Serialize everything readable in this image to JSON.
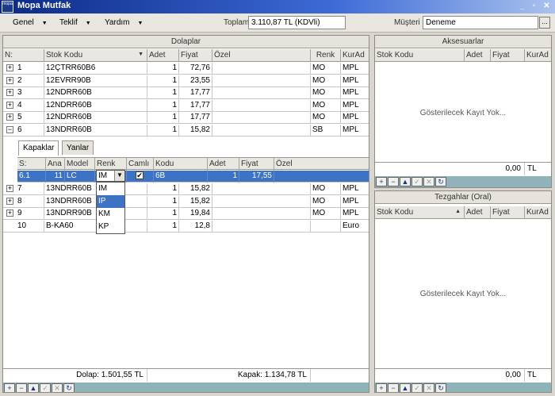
{
  "window": {
    "app_icon_text": "mopa",
    "title": "Mopa Mutfak",
    "minimize": "_",
    "restore": "▫",
    "close": "✕"
  },
  "menu": {
    "items": [
      {
        "label": "Genel",
        "accel": "G"
      },
      {
        "label": "Teklif",
        "accel": "T"
      },
      {
        "label": "Yardım",
        "accel": "Y"
      }
    ],
    "arrow": "▼"
  },
  "toolbar": {
    "total_label": "Toplam",
    "total_value": "3.110,87 TL (KDVli)",
    "customer_label": "Müşteri :",
    "customer_value": "Deneme",
    "ellipsis": "..."
  },
  "dolaplar": {
    "title": "Dolaplar",
    "columns": [
      "N:",
      "Stok Kodu",
      "Adet",
      "Fiyat",
      "Özel",
      "Renk",
      "KurAd"
    ],
    "rows_top": [
      {
        "exp": "+",
        "n": "1",
        "stok": "12ÇTRR60B6",
        "adet": "1",
        "fiyat": "72,76",
        "ozel": "",
        "renk": "MO",
        "kurad": "MPL"
      },
      {
        "exp": "+",
        "n": "2",
        "stok": "12EVRR90B",
        "adet": "1",
        "fiyat": "23,55",
        "ozel": "",
        "renk": "MO",
        "kurad": "MPL"
      },
      {
        "exp": "+",
        "n": "3",
        "stok": "12NDRR60B",
        "adet": "1",
        "fiyat": "17,77",
        "ozel": "",
        "renk": "MO",
        "kurad": "MPL"
      },
      {
        "exp": "+",
        "n": "4",
        "stok": "12NDRR60B",
        "adet": "1",
        "fiyat": "17,77",
        "ozel": "",
        "renk": "MO",
        "kurad": "MPL"
      },
      {
        "exp": "+",
        "n": "5",
        "stok": "12NDRR60B",
        "adet": "1",
        "fiyat": "17,77",
        "ozel": "",
        "renk": "MO",
        "kurad": "MPL"
      },
      {
        "exp": "−",
        "n": "6",
        "stok": "13NDRR60B",
        "adet": "1",
        "fiyat": "15,82",
        "ozel": "",
        "renk": "SB",
        "kurad": "MPL"
      }
    ],
    "rows_bottom": [
      {
        "exp": "+",
        "n": "7",
        "stok": "13NDRR60B",
        "adet": "1",
        "fiyat": "15,82",
        "ozel": "",
        "renk": "MO",
        "kurad": "MPL"
      },
      {
        "exp": "+",
        "n": "8",
        "stok": "13NDRR60B",
        "adet": "1",
        "fiyat": "15,82",
        "ozel": "",
        "renk": "MO",
        "kurad": "MPL"
      },
      {
        "exp": "+",
        "n": "9",
        "stok": "13NDRR90B",
        "adet": "1",
        "fiyat": "19,84",
        "ozel": "",
        "renk": "MO",
        "kurad": "MPL"
      },
      {
        "exp": "",
        "n": "10",
        "stok": "B-KA60",
        "adet": "1",
        "fiyat": "12,8",
        "ozel": "",
        "renk": "",
        "kurad": "Euro"
      }
    ],
    "sort_arrow": "▼",
    "dolap_total": "Dolap: 1.501,55 TL",
    "kapak_total": "Kapak: 1.134,78 TL"
  },
  "detail": {
    "tabs": [
      "Kapaklar",
      "Yanlar"
    ],
    "columns": [
      "S:",
      "Ana",
      "Model",
      "Renk",
      "Camlı",
      "Kodu",
      "Adet",
      "Fiyat",
      "Özel"
    ],
    "row": {
      "s": "6.1",
      "ana": "11",
      "model": "LC",
      "renk": "IM",
      "camli": "✔",
      "kodu": "6B",
      "adet": "1",
      "fiyat": "17,55",
      "ozel": ""
    },
    "dropdown_options": [
      "IM",
      "IP",
      "KM",
      "KP"
    ],
    "dropdown_selected": "IP",
    "combo_arrow": "▼"
  },
  "aksesuarlar": {
    "title": "Aksesuarlar",
    "columns": [
      "Stok Kodu",
      "Adet",
      "Fiyat",
      "KurAd"
    ],
    "empty_text": "Gösterilecek Kayıt Yok...",
    "total_value": "0,00",
    "total_unit": "TL"
  },
  "tezgahlar": {
    "title": "Tezgahlar (Oral)",
    "columns": [
      "Stok Kodu",
      "Adet",
      "Fiyat",
      "KurAd"
    ],
    "sort_arrow": "▲",
    "empty_text": "Gösterilecek Kayıt Yok...",
    "total_value": "0,00",
    "total_unit": "TL"
  },
  "navigator": {
    "first": "+",
    "delete": "−",
    "up": "▲",
    "post": "✓",
    "cancel": "✕",
    "refresh": "↻"
  }
}
